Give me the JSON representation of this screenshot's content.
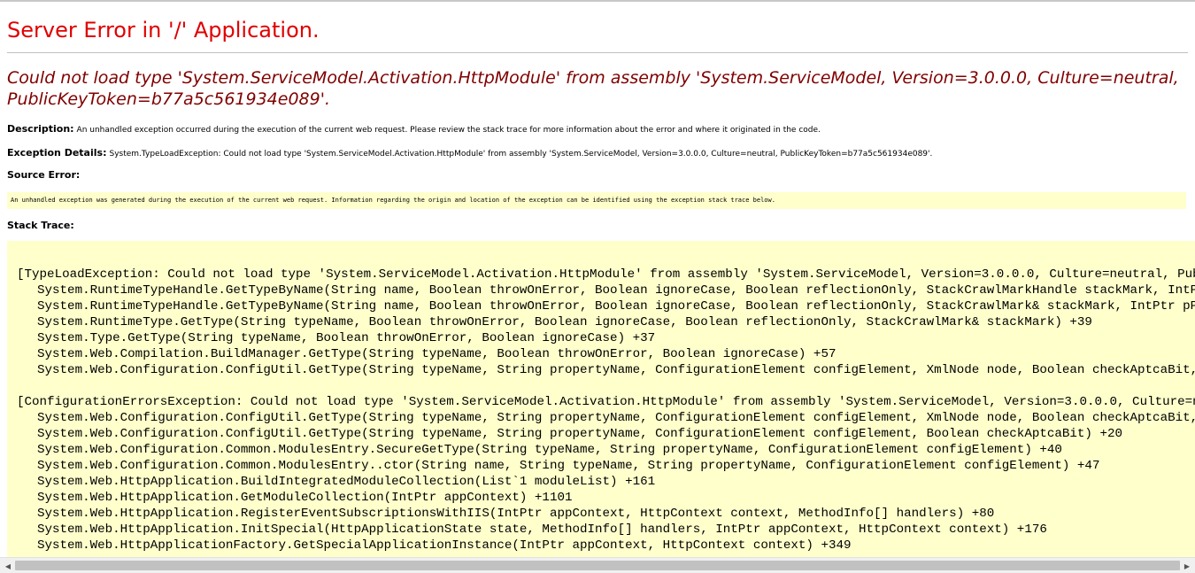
{
  "page": {
    "title": "Server Error in '/' Application.",
    "error_message": "Could not load type 'System.ServiceModel.Activation.HttpModule' from assembly 'System.ServiceModel, Version=3.0.0.0, Culture=neutral, PublicKeyToken=b77a5c561934e089'.",
    "description_label": "Description:",
    "description_text": "An unhandled exception occurred during the execution of the current web request. Please review the stack trace for more information about the error and where it originated in the code.",
    "exception_label": "Exception Details:",
    "exception_text": "System.TypeLoadException: Could not load type 'System.ServiceModel.Activation.HttpModule' from assembly 'System.ServiceModel, Version=3.0.0.0, Culture=neutral, PublicKeyToken=b77a5c561934e089'.",
    "source_label": "Source Error:",
    "source_text": "An unhandled exception was generated during the execution of the current web request. Information regarding the origin and location of the exception can be identified using the exception stack trace below.",
    "stack_label": "Stack Trace:"
  },
  "stack_trace": [
    "[TypeLoadException: Could not load type 'System.ServiceModel.Activation.HttpModule' from assembly 'System.ServiceModel, Version=3.0.0.0, Culture=neutral, PublicKeyTo",
    "System.RuntimeTypeHandle.GetTypeByName(String name, Boolean throwOnError, Boolean ignoreCase, Boolean reflectionOnly, StackCrawlMarkHandle stackMark, IntPtr pPriv",
    "System.RuntimeTypeHandle.GetTypeByName(String name, Boolean throwOnError, Boolean ignoreCase, Boolean reflectionOnly, StackCrawlMark& stackMark, IntPtr pPrivHostB",
    "System.RuntimeType.GetType(String typeName, Boolean throwOnError, Boolean ignoreCase, Boolean reflectionOnly, StackCrawlMark& stackMark) +39",
    "System.Type.GetType(String typeName, Boolean throwOnError, Boolean ignoreCase) +37",
    "System.Web.Compilation.BuildManager.GetType(String typeName, Boolean throwOnError, Boolean ignoreCase) +57",
    "System.Web.Configuration.ConfigUtil.GetType(String typeName, String propertyName, ConfigurationElement configElement, XmlNode node, Boolean checkAptcaBit, Boolean",
    "",
    "[ConfigurationErrorsException: Could not load type 'System.ServiceModel.Activation.HttpModule' from assembly 'System.ServiceModel, Version=3.0.0.0, Culture=neutral,",
    "System.Web.Configuration.ConfigUtil.GetType(String typeName, String propertyName, ConfigurationElement configElement, XmlNode node, Boolean checkAptcaBit, Boolean",
    "System.Web.Configuration.ConfigUtil.GetType(String typeName, String propertyName, ConfigurationElement configElement, Boolean checkAptcaBit) +20",
    "System.Web.Configuration.Common.ModulesEntry.SecureGetType(String typeName, String propertyName, ConfigurationElement configElement) +40",
    "System.Web.Configuration.Common.ModulesEntry..ctor(String name, String typeName, String propertyName, ConfigurationElement configElement) +47",
    "System.Web.HttpApplication.BuildIntegratedModuleCollection(List`1 moduleList) +161",
    "System.Web.HttpApplication.GetModuleCollection(IntPtr appContext) +1101",
    "System.Web.HttpApplication.RegisterEventSubscriptionsWithIIS(IntPtr appContext, HttpContext context, MethodInfo[] handlers) +80",
    "System.Web.HttpApplication.InitSpecial(HttpApplicationState state, MethodInfo[] handlers, IntPtr appContext, HttpContext context) +176",
    "System.Web.HttpApplicationFactory.GetSpecialApplicationInstance(IntPtr appContext, HttpContext context) +349"
  ],
  "scrollbar": {
    "left_arrow_icon": "triangle-left-icon",
    "right_arrow_icon": "triangle-right-icon"
  }
}
